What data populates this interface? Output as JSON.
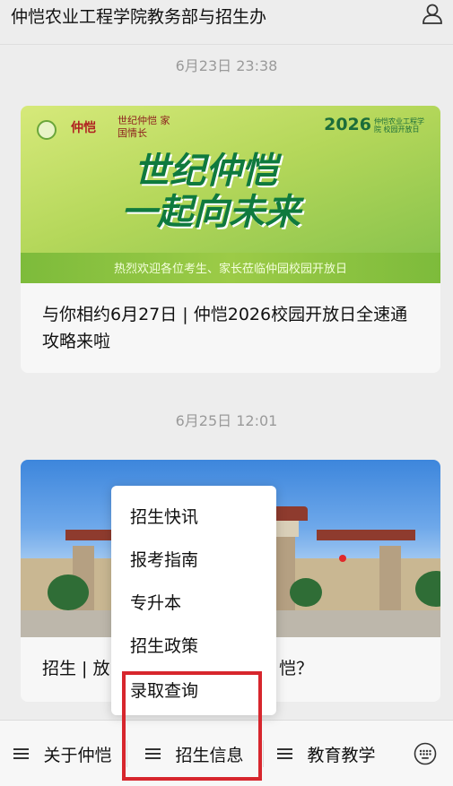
{
  "header": {
    "title": "仲恺农业工程学院教务部与招生办",
    "profile_icon": "person-icon"
  },
  "messages": [
    {
      "timestamp": "6月23日 23:38",
      "banner": {
        "logo_text": "仲恺",
        "logo_script": "世纪仲恺 家国情长",
        "year_badge": "2026",
        "year_badge_sub": "仲恺农业工程学院 校园开放日",
        "slogan_line1": "世纪仲恺",
        "slogan_line2": "一起向未来",
        "subtitle": "热烈欢迎各位考生、家长莅临仲园校园开放日"
      },
      "caption": "与你相约6月27日 | 仲恺2026校园开放日全速通攻略来啦"
    },
    {
      "timestamp": "6月25日 12:01",
      "caption_left": "招生 | 放",
      "caption_right": "恺？"
    }
  ],
  "popup_menu": {
    "items": [
      "招生快讯",
      "报考指南",
      "专升本",
      "招生政策",
      "录取查询"
    ]
  },
  "bottom_nav": {
    "items": [
      {
        "label": "关于仲恺",
        "icon": "menu-icon"
      },
      {
        "label": "招生信息",
        "icon": "menu-icon"
      },
      {
        "label": "教育教学",
        "icon": "menu-icon"
      }
    ],
    "keyboard_icon": "keyboard-icon"
  },
  "colors": {
    "highlight": "#d7262d",
    "background": "#ededed",
    "slogan": "#0f7a3e"
  }
}
